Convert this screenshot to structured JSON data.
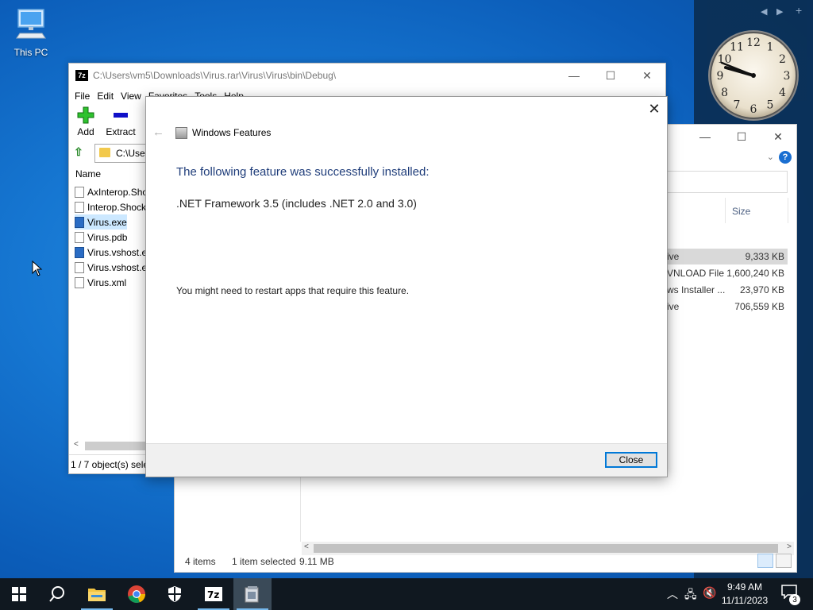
{
  "desktop": {
    "icons": [
      {
        "label": "This PC"
      }
    ]
  },
  "clock_gadget": {
    "numbers": [
      "12",
      "1",
      "2",
      "3",
      "4",
      "5",
      "6",
      "7",
      "8",
      "9",
      "10",
      "11"
    ]
  },
  "sevenzip": {
    "title": "C:\\Users\\vm5\\Downloads\\Virus.rar\\Virus\\Virus\\bin\\Debug\\",
    "menu": [
      "File",
      "Edit",
      "View",
      "Favorites",
      "Tools",
      "Help"
    ],
    "toolbar": {
      "add_label": "Add",
      "extract_label": "Extract"
    },
    "address": "C:\\User",
    "column_name": "Name",
    "files": [
      {
        "name": "AxInterop.Shoc",
        "type": "dll"
      },
      {
        "name": "Interop.Shock",
        "type": "dll"
      },
      {
        "name": "Virus.exe",
        "type": "exe"
      },
      {
        "name": "Virus.pdb",
        "type": "file"
      },
      {
        "name": "Virus.vshost.e",
        "type": "exe"
      },
      {
        "name": "Virus.vshost.e",
        "type": "file"
      },
      {
        "name": "Virus.xml",
        "type": "xml"
      }
    ],
    "status": "1 / 7 object(s) sele"
  },
  "explorer": {
    "column_size": "Size",
    "rows": [
      {
        "type": "ive",
        "size": "9,333 KB",
        "selected": true
      },
      {
        "type": "VNLOAD File",
        "size": "1,600,240 KB",
        "selected": false
      },
      {
        "type": "ws Installer ...",
        "size": "23,970 KB",
        "selected": false
      },
      {
        "type": "ive",
        "size": "706,559 KB",
        "selected": false
      }
    ],
    "status": {
      "items": "4 items",
      "selected": "1 item selected",
      "size": "9.11 MB"
    }
  },
  "dialog": {
    "app_title": "Windows Features",
    "heading": "The following feature was successfully installed:",
    "feature": ".NET Framework 3.5 (includes .NET 2.0 and 3.0)",
    "note": "You might need to restart apps that require this feature.",
    "close_button": "Close"
  },
  "taskbar": {
    "time": "9:49 AM",
    "date": "11/11/2023",
    "notification_count": "3"
  },
  "colors": {
    "desktop": "#1677d2",
    "taskbar": "#101820",
    "dialog_heading": "#1f3d7a",
    "accent": "#0078d7"
  }
}
